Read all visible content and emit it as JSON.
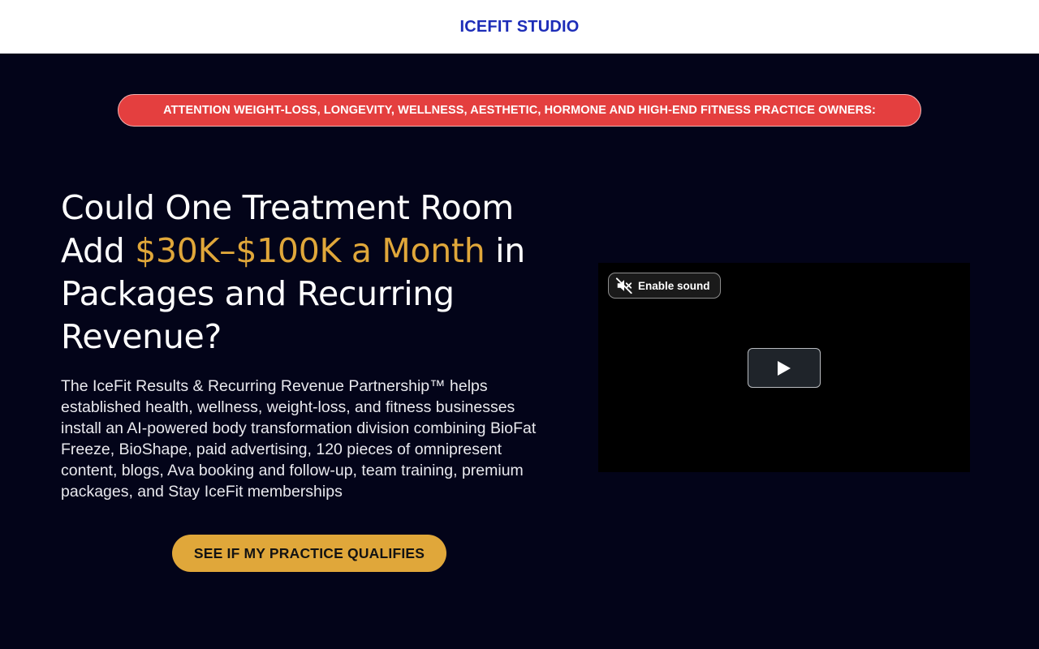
{
  "header": {
    "brand": "ICEFIT STUDIO"
  },
  "hero": {
    "attention_banner": "ATTENTION WEIGHT-LOSS, LONGEVITY, WELLNESS, AESTHETIC, HORMONE AND HIGH-END FITNESS PRACTICE OWNERS:",
    "headline": {
      "part1": "Could One Treatment Room Add ",
      "highlight": "$30K–$100K a Month",
      "part2": " in Packages and Recurring Revenue?"
    },
    "subcopy": "The IceFit Results & Recurring Revenue Partnership™ helps established health, wellness, weight-loss, and fitness businesses install an AI-powered body transformation division combining BioFat Freeze, BioShape, paid advertising, 120 pieces of omnipresent content, blogs, Ava booking and follow-up, team training, premium packages, and Stay IceFit memberships",
    "cta_label": "SEE IF MY PRACTICE QUALIFIES"
  },
  "video": {
    "sound_label": "Enable sound",
    "sound_icon": "speaker-muted-icon",
    "play_icon": "play-icon"
  },
  "colors": {
    "brand_blue": "#1d2db8",
    "hero_bg": "#030419",
    "attention_red": "#e43f3f",
    "accent_gold": "#e0a73a"
  }
}
